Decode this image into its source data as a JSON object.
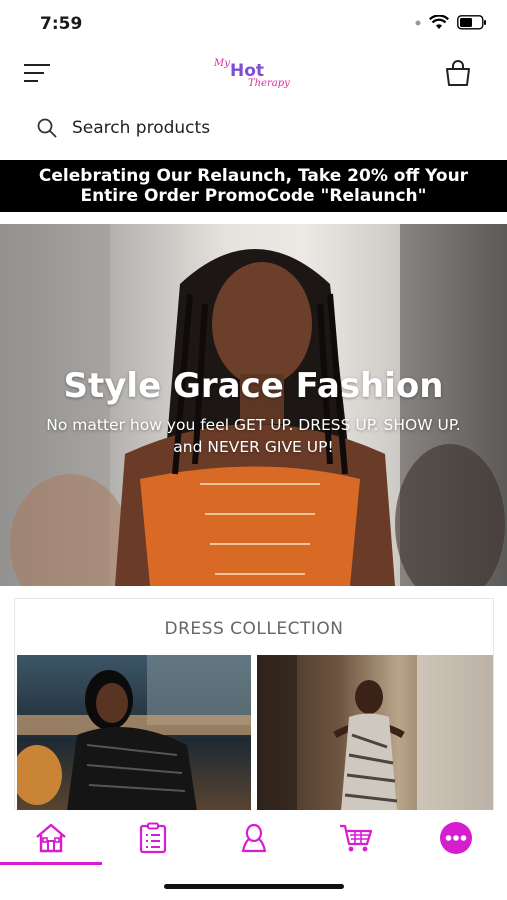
{
  "status": {
    "time": "7:59"
  },
  "header": {
    "logo_text_top": "My",
    "logo_text_mid": "Hot",
    "logo_text_bottom": "Therapy"
  },
  "search": {
    "placeholder": "Search products"
  },
  "promo": {
    "text": "Celebrating Our Relaunch, Take 20% off Your Entire Order PromoCode \"Relaunch\""
  },
  "hero": {
    "title": "Style Grace Fashion",
    "subtitle": "No matter how you feel GET UP. DRESS UP. SHOW UP. and NEVER GIVE UP!"
  },
  "collection": {
    "title": "DRESS COLLECTION"
  },
  "tabbar": {
    "accent_color": "#d61ed0",
    "items": [
      {
        "icon": "home-icon",
        "active": true
      },
      {
        "icon": "clipboard-list-icon",
        "active": false
      },
      {
        "icon": "user-icon",
        "active": false
      },
      {
        "icon": "cart-icon",
        "active": false
      },
      {
        "icon": "more-icon",
        "active": false
      }
    ]
  }
}
